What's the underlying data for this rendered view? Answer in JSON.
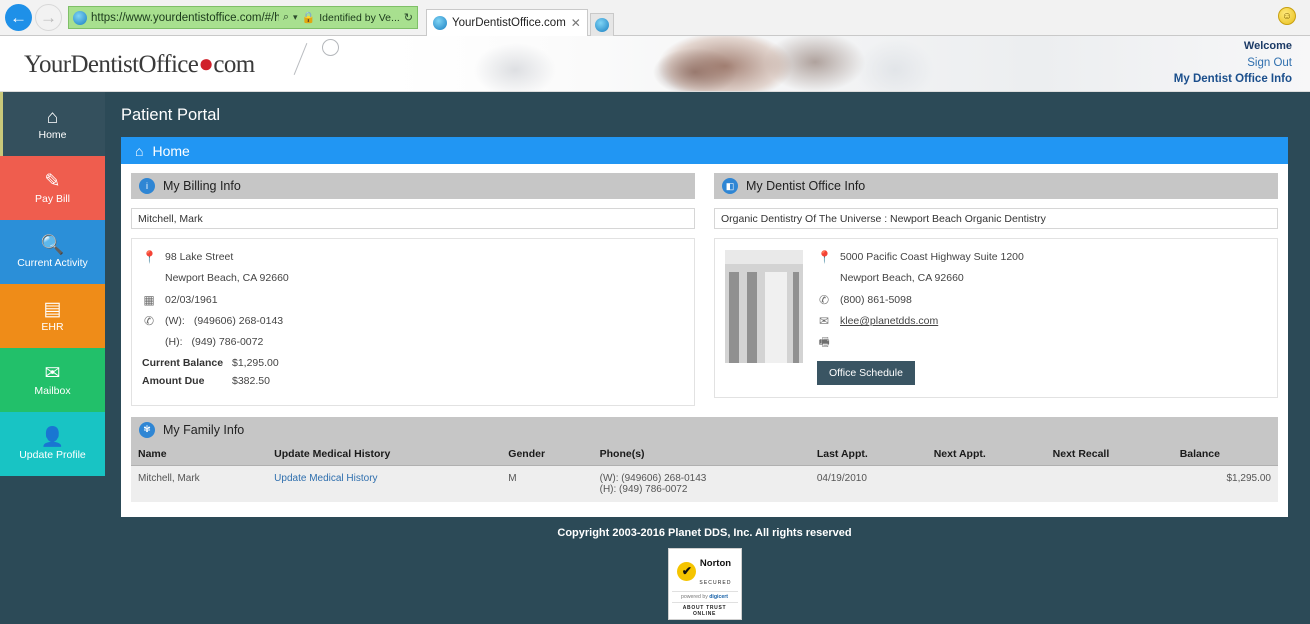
{
  "browser": {
    "url": "https://www.yourdentistoffice.com/#/h",
    "security_label": "Identified by Ve...",
    "tab_title": "YourDentistOffice.com",
    "back_icon": "←",
    "forward_icon": "→",
    "search_icon": "⌕",
    "dropdown_icon": "▾",
    "lock_icon": "🔒",
    "refresh_icon": "↻",
    "close_icon": "✕",
    "new_tab_icon": "⌂",
    "smiley_icon": "☺"
  },
  "header": {
    "logo_part1": "YourDentistOffice",
    "logo_dot": "●",
    "logo_part2": "com",
    "welcome": "Welcome",
    "sign_out": "Sign Out",
    "office_info_link": "My Dentist Office Info"
  },
  "sidebar": {
    "items": [
      {
        "label": "Home",
        "icon": "⌂",
        "icon_name": "home-icon",
        "color": "#34505d",
        "active": true
      },
      {
        "label": "Pay Bill",
        "icon": "✎",
        "icon_name": "pay-bill-icon",
        "color": "#ef5d4e",
        "active": false
      },
      {
        "label": "Current Activity",
        "icon": "🔍",
        "icon_name": "magnifier-icon",
        "color": "#2b8fd8",
        "active": false
      },
      {
        "label": "EHR",
        "icon": "▤",
        "icon_name": "ehr-record-icon",
        "color": "#ef8c18",
        "active": false
      },
      {
        "label": "Mailbox",
        "icon": "✉",
        "icon_name": "envelope-icon",
        "color": "#22c06a",
        "active": false
      },
      {
        "label": "Update Profile",
        "icon": "👤",
        "icon_name": "user-refresh-icon",
        "color": "#18c4c4",
        "active": false
      }
    ]
  },
  "page": {
    "title": "Patient Portal",
    "breadcrumb": "Home",
    "breadcrumb_icon": "⌂"
  },
  "billing": {
    "panel_title": "My Billing Info",
    "panel_icon": "i",
    "patient_name": "Mitchell, Mark",
    "address_line1": "98 Lake Street",
    "address_line2": "Newport Beach, CA 92660",
    "dob": "02/03/1961",
    "phone_work_label": "(W):",
    "phone_work": "(949606) 268-0143",
    "phone_home_label": "(H):",
    "phone_home": "(949) 786-0072",
    "current_balance_label": "Current Balance",
    "current_balance": "$1,295.00",
    "amount_due_label": "Amount Due",
    "amount_due": "$382.50",
    "pin_icon": "📍",
    "cal_icon": "▦",
    "phone_icon": "✆"
  },
  "office": {
    "panel_title": "My Dentist Office Info",
    "panel_icon": "◧",
    "office_name": "Organic Dentistry Of The Universe : Newport Beach Organic Dentistry",
    "address_line1": "5000 Pacific Coast Highway Suite 1200",
    "address_line2": "Newport Beach, CA 92660",
    "phone": "(800) 861-5098",
    "email": "klee@planetdds.com",
    "schedule_button": "Office Schedule",
    "pin_icon": "📍",
    "phone_icon": "✆",
    "mail_icon": "✉",
    "fax_icon": "🖷"
  },
  "family": {
    "panel_title": "My Family Info",
    "panel_icon": "✾",
    "columns": [
      "Name",
      "Update Medical History",
      "Gender",
      "Phone(s)",
      "Last Appt.",
      "Next Appt.",
      "Next Recall",
      "Balance"
    ],
    "rows": [
      {
        "name": "Mitchell, Mark",
        "update_link": "Update Medical History",
        "gender": "M",
        "phone_work": "(W): (949606) 268-0143",
        "phone_home": "(H): (949) 786-0072",
        "last_appt": "04/19/2010",
        "next_appt": "",
        "next_recall": "",
        "balance": "$1,295.00"
      }
    ]
  },
  "footer": {
    "copyright": "Copyright 2003-2016 Planet DDS, Inc. All rights reserved",
    "norton_check": "✔",
    "norton_word": "Norton",
    "norton_secured": "SECURED",
    "norton_powered": "powered by",
    "norton_brand": "digicert",
    "norton_about": "ABOUT TRUST ONLINE"
  }
}
